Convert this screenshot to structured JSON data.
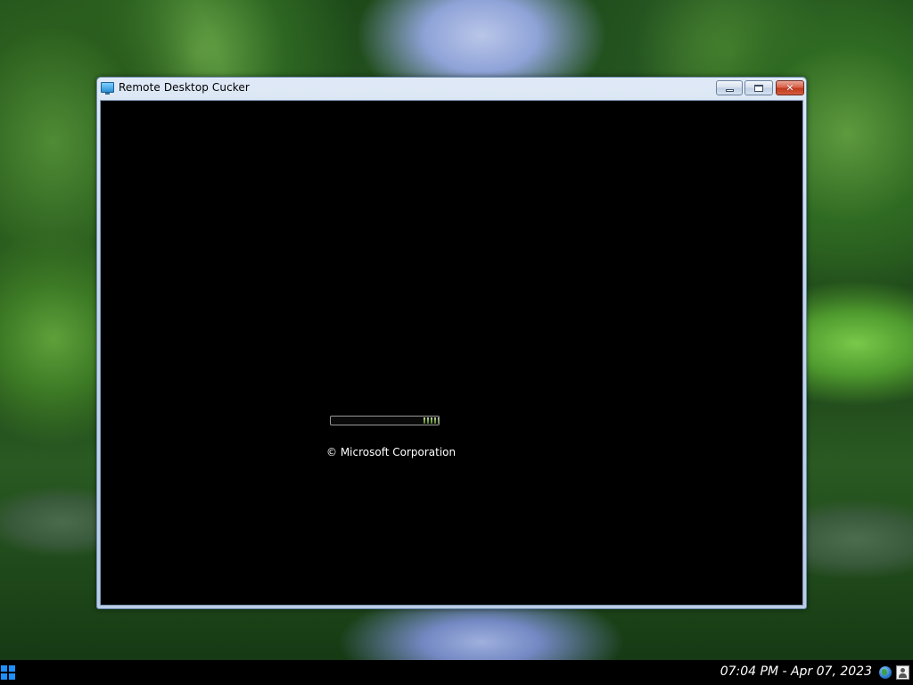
{
  "window": {
    "title": "Remote Desktop Cucker",
    "app_icon": "monitor-icon",
    "buttons": {
      "minimize_icon": "minimize-icon",
      "maximize_icon": "maximize-icon",
      "close_icon": "close-icon",
      "close_glyph": "✕"
    }
  },
  "boot_screen": {
    "progress_indicator": "animated-loading-bar",
    "copyright": "© Microsoft Corporation"
  },
  "taskbar": {
    "start_icon": "windows-logo-icon",
    "clock": "07:04 PM - Apr 07, 2023",
    "tray_icons": [
      "globe-icon",
      "user-icon"
    ]
  },
  "colors": {
    "start_accent": "#1e90ff",
    "close_button": "#c2391f",
    "progress_green": "#7fa84f"
  }
}
